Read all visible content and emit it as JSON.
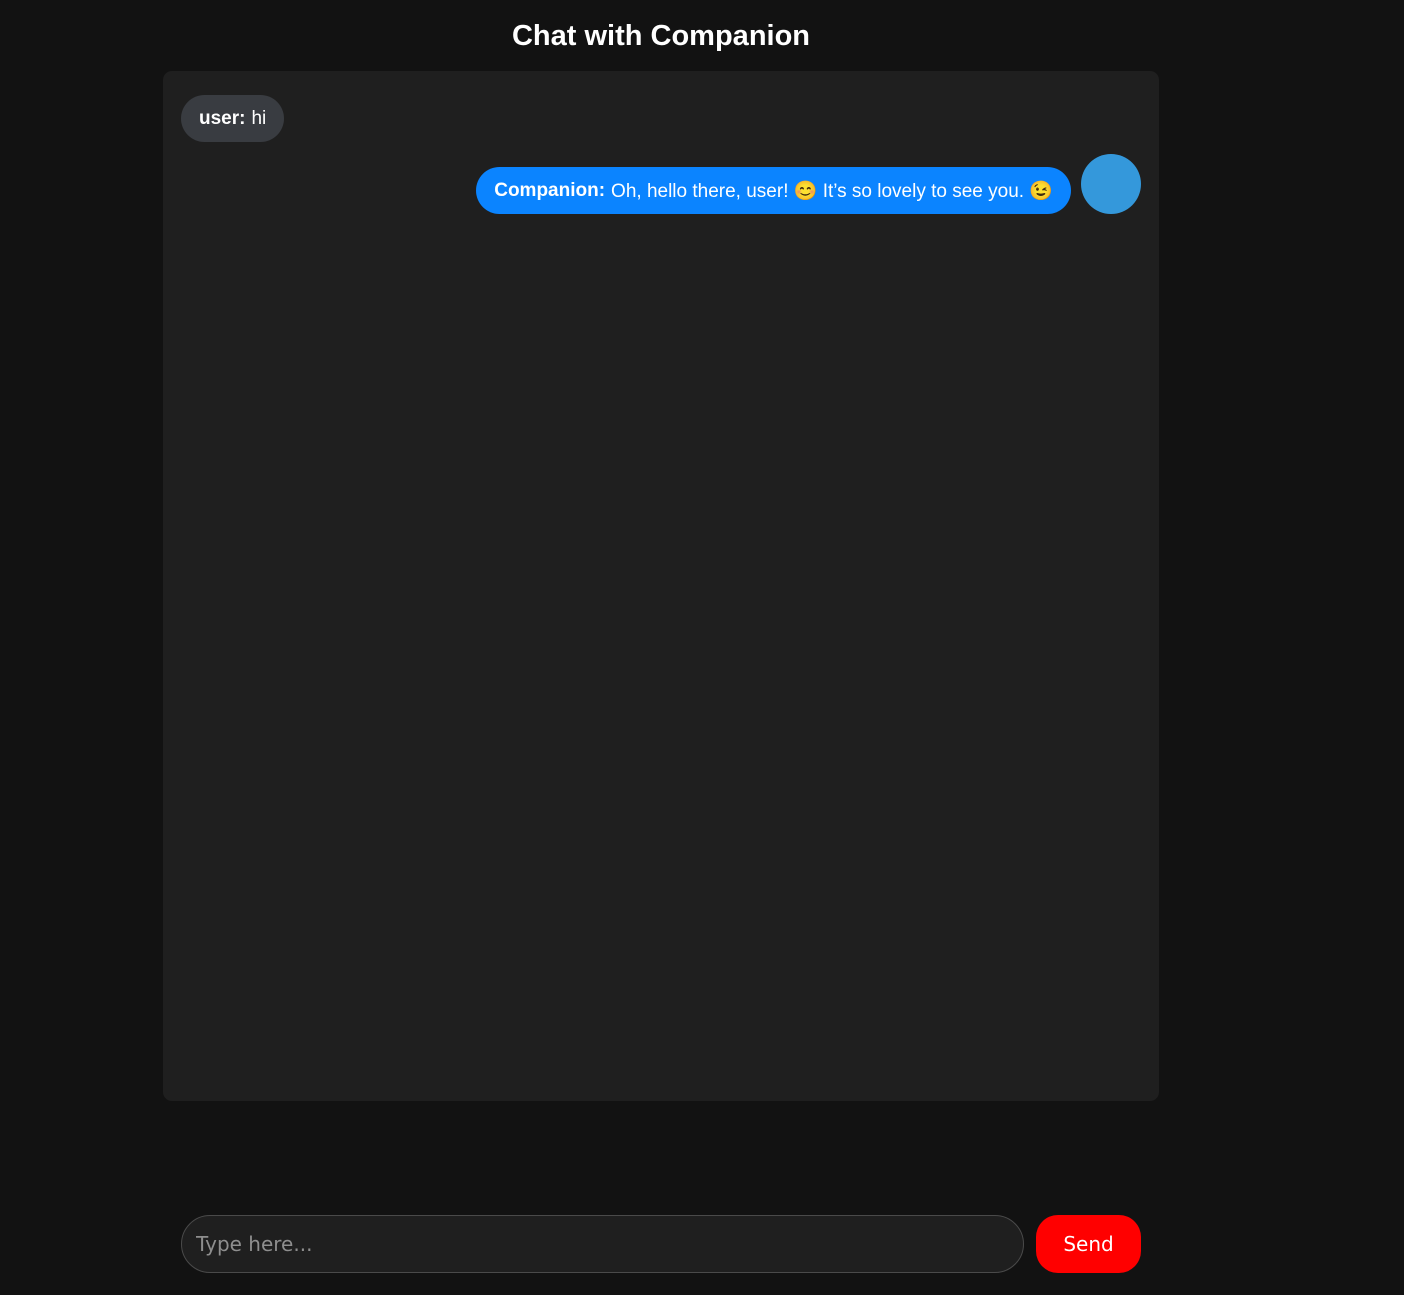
{
  "header": {
    "title": "Chat with Companion"
  },
  "messages": [
    {
      "role": "user",
      "sender": "user:",
      "text": "hi"
    },
    {
      "role": "companion",
      "sender": "Companion:",
      "text": "Oh, hello there, user! 😊 It’s so lovely to see you. 😉"
    }
  ],
  "composer": {
    "placeholder": "Type here...",
    "value": "",
    "send_label": "Send"
  },
  "colors": {
    "page_background": "#121212",
    "panel_background": "#1f1f1f",
    "user_bubble": "#393c41",
    "companion_bubble": "#0b84ff",
    "avatar": "#3498db",
    "send_button": "#ff0000"
  }
}
